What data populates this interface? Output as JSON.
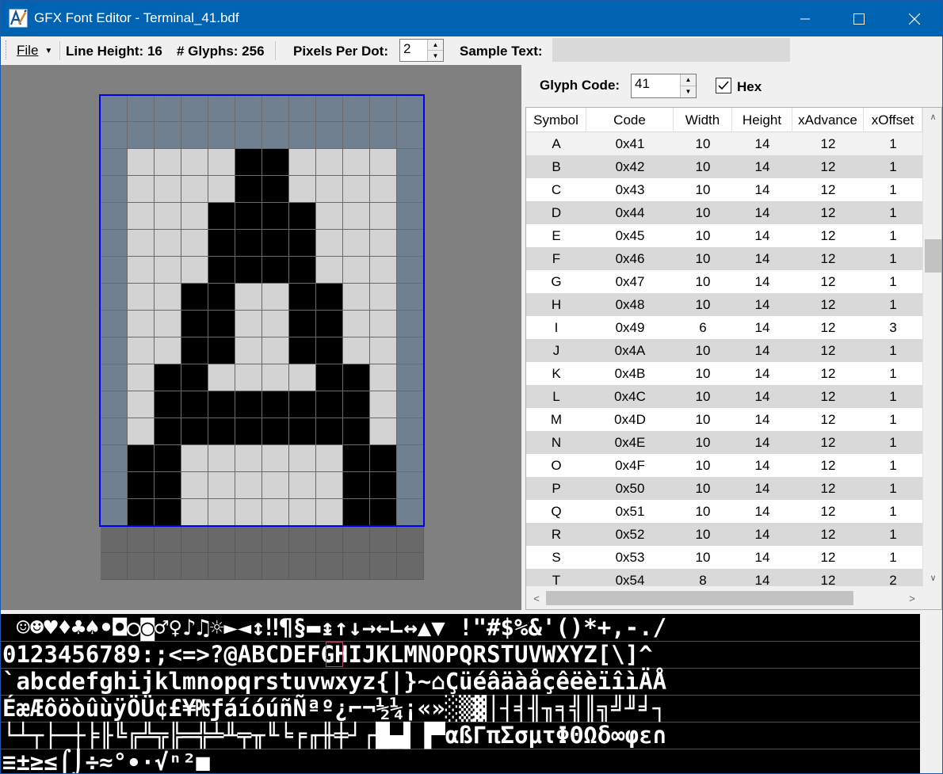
{
  "window": {
    "title": "GFX Font Editor - Terminal_41.bdf",
    "icon": "font-editor-icon"
  },
  "toolbar": {
    "file_label": "File",
    "line_height_label": "Line Height: 16",
    "glyphs_label": "# Glyphs: 256",
    "pixels_per_dot_label": "Pixels Per Dot:",
    "pixels_per_dot_value": "2",
    "sample_text_label": "Sample Text:",
    "sample_text_value": ""
  },
  "glyph_panel": {
    "glyph_code_label": "Glyph Code:",
    "glyph_code_value": "41",
    "hex_label": "Hex",
    "hex_checked": true
  },
  "editor": {
    "accent": "#0000ee",
    "bitmap_rows": [
      "000000000000",
      "000000000000",
      "011112211110",
      "011112211110",
      "011122221110",
      "011122221110",
      "011122221110",
      "011221122110",
      "011221122110",
      "011221122110",
      "012211112210",
      "012222222210",
      "012222222210",
      "022111111220",
      "022111111220",
      "022111111220",
      "333333333333",
      "333333333333"
    ]
  },
  "table": {
    "columns": [
      "Symbol",
      "Code",
      "Width",
      "Height",
      "xAdvance",
      "xOffset"
    ],
    "rows": [
      [
        "A",
        "0x41",
        "10",
        "14",
        "12",
        "1"
      ],
      [
        "B",
        "0x42",
        "10",
        "14",
        "12",
        "1"
      ],
      [
        "C",
        "0x43",
        "10",
        "14",
        "12",
        "1"
      ],
      [
        "D",
        "0x44",
        "10",
        "14",
        "12",
        "1"
      ],
      [
        "E",
        "0x45",
        "10",
        "14",
        "12",
        "1"
      ],
      [
        "F",
        "0x46",
        "10",
        "14",
        "12",
        "1"
      ],
      [
        "G",
        "0x47",
        "10",
        "14",
        "12",
        "1"
      ],
      [
        "H",
        "0x48",
        "10",
        "14",
        "12",
        "1"
      ],
      [
        "I",
        "0x49",
        "6",
        "14",
        "12",
        "3"
      ],
      [
        "J",
        "0x4A",
        "10",
        "14",
        "12",
        "1"
      ],
      [
        "K",
        "0x4B",
        "10",
        "14",
        "12",
        "1"
      ],
      [
        "L",
        "0x4C",
        "10",
        "14",
        "12",
        "1"
      ],
      [
        "M",
        "0x4D",
        "10",
        "14",
        "12",
        "1"
      ],
      [
        "N",
        "0x4E",
        "10",
        "14",
        "12",
        "1"
      ],
      [
        "O",
        "0x4F",
        "10",
        "14",
        "12",
        "1"
      ],
      [
        "P",
        "0x50",
        "10",
        "14",
        "12",
        "1"
      ],
      [
        "Q",
        "0x51",
        "10",
        "14",
        "12",
        "1"
      ],
      [
        "R",
        "0x52",
        "10",
        "14",
        "12",
        "1"
      ],
      [
        "S",
        "0x53",
        "10",
        "14",
        "12",
        "1"
      ],
      [
        "T",
        "0x54",
        "8",
        "14",
        "12",
        "2"
      ]
    ]
  },
  "glyph_strip": {
    "rows": [
      " ☺☻♥♦♣♠•◘○◙♂♀♪♫☼►◄↕‼¶§▬↨↑↓→←∟↔▲▼ !\"#$%&'()*+,-./",
      "0123456789:;<=>?@ABCDEFGHIJKLMNOPQRSTUVWXYZ[\\]^",
      "`abcdefghijklmnopqrstuvwxyz{|}~⌂ÇüéâäàåçêëèïîìÄÅ",
      "ÉæÆôöòûùÿÖÜ¢£¥₧ƒáíóúñÑªº¿⌐¬½¼¡«»░▒▓│┤╡╢╖╕╣║╗╝╜╛┐",
      "└┴┬├─┼╞╟╚╔╩╦╠═╬╧╨╤╥╙╘╒╓╫╪┘┌█▄▌▐▀αßΓπΣσµτΦΘΩδ∞φε∩",
      "≡±≥≤⌠⌡÷≈°∙·√ⁿ²■ "
    ]
  }
}
